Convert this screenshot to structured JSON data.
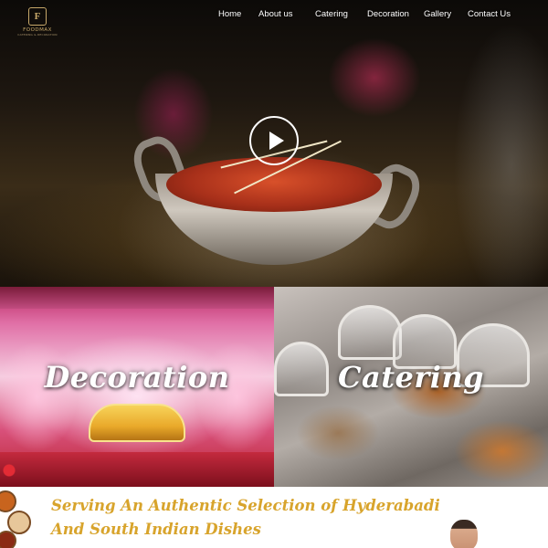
{
  "brand": {
    "logo_mark": "F",
    "name": "FOODMAX",
    "tagline": "CATERING & DECORATION"
  },
  "nav": {
    "items": [
      {
        "label": "Home"
      },
      {
        "label": "About us"
      },
      {
        "label": "Catering"
      },
      {
        "label": "Decoration"
      },
      {
        "label": "Gallery"
      },
      {
        "label": "Contact Us"
      }
    ]
  },
  "hero": {
    "play_icon": "play-icon"
  },
  "panels": {
    "decoration": {
      "title": "Decoration"
    },
    "catering": {
      "title": "Catering"
    }
  },
  "intro": {
    "headline_line1": "Serving An Authentic Selection of Hyderabadi",
    "headline_line2": "And South Indian Dishes"
  },
  "colors": {
    "accent_gold": "#d8a42c",
    "nav_text": "#ffffff"
  }
}
